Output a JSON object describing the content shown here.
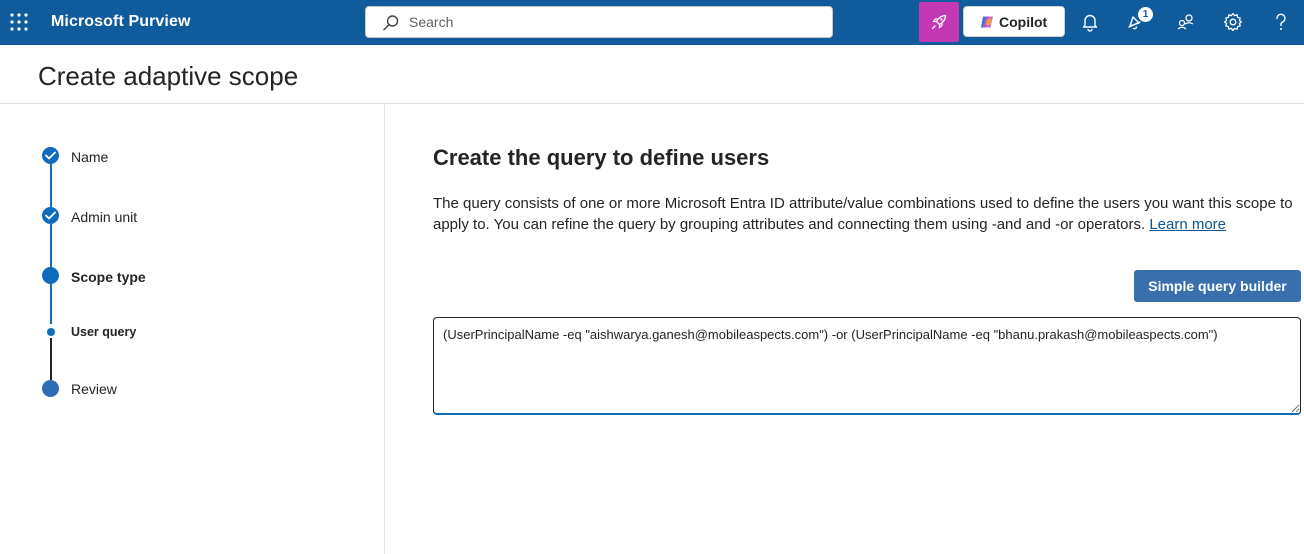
{
  "topbar": {
    "app_name": "Microsoft Purview",
    "search_placeholder": "Search",
    "copilot_label": "Copilot",
    "notification_badge": "1",
    "icons": [
      "waffle-icon",
      "search-icon",
      "rocket-icon",
      "copilot-logo-icon",
      "bell-icon",
      "notification-icon",
      "people-icon",
      "gear-icon",
      "help-icon"
    ]
  },
  "page": {
    "title": "Create adaptive scope"
  },
  "stepper": {
    "steps": [
      {
        "label": "Name",
        "state": "completed"
      },
      {
        "label": "Admin unit",
        "state": "completed"
      },
      {
        "label": "Scope type",
        "state": "current"
      },
      {
        "label": "User query",
        "state": "current-substep"
      },
      {
        "label": "Review",
        "state": "upcoming"
      }
    ]
  },
  "content": {
    "title": "Create the query to define users",
    "description": "The query consists of one or more Microsoft Entra ID attribute/value combinations used to define the users you want this scope to apply to. You can refine the query by grouping attributes and connecting them using -and and -or operators.",
    "learn_more": "Learn more",
    "simple_query_button": "Simple query builder",
    "query_value": "(UserPrincipalName -eq \"aishwarya.ganesh@mobileaspects.com\") -or (UserPrincipalName -eq \"bhanu.prakash@mobileaspects.com\")\n"
  },
  "colors": {
    "topbar": "#0f5b9c",
    "accent": "#0f6cbd",
    "rocket_button": "#c239b3",
    "primary_button": "#3a6fae"
  }
}
